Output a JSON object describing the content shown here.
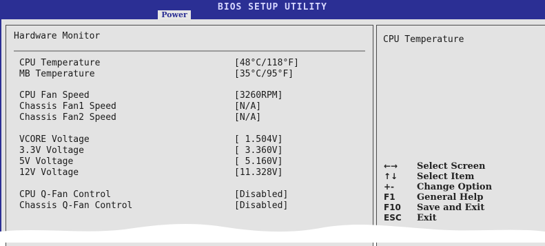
{
  "header": {
    "title": "BIOS SETUP UTILITY",
    "active_tab": "Power"
  },
  "main": {
    "section_title": "Hardware Monitor",
    "items": [
      {
        "label": "CPU Temperature",
        "value": "[48°C/118°F]"
      },
      {
        "label": "MB Temperature",
        "value": "[35°C/95°F]"
      },
      {
        "label": "CPU Fan Speed",
        "value": "[3260RPM]"
      },
      {
        "label": "Chassis Fan1 Speed",
        "value": "[N/A]"
      },
      {
        "label": "Chassis Fan2 Speed",
        "value": "[N/A]"
      },
      {
        "label": "VCORE Voltage",
        "value": "[ 1.504V]"
      },
      {
        "label": "3.3V Voltage",
        "value": "[ 3.360V]"
      },
      {
        "label": "5V Voltage",
        "value": "[ 5.160V]"
      },
      {
        "label": "12V Voltage",
        "value": "[11.328V]"
      },
      {
        "label": "CPU Q-Fan Control",
        "value": "[Disabled]"
      },
      {
        "label": "Chassis Q-Fan Control",
        "value": "[Disabled]"
      }
    ]
  },
  "help": {
    "title": "CPU Temperature",
    "keys": [
      {
        "key": "←→",
        "desc": "Select Screen"
      },
      {
        "key": "↑↓",
        "desc": "Select Item"
      },
      {
        "key": "+-",
        "desc": "Change Option"
      },
      {
        "key": "F1",
        "desc": "General Help"
      },
      {
        "key": "F10",
        "desc": "Save and Exit"
      },
      {
        "key": "ESC",
        "desc": "Exit"
      }
    ]
  },
  "colors": {
    "header_bg": "#2b2f94",
    "panel_bg": "#e3e3e3",
    "text": "#1a1a1a"
  }
}
